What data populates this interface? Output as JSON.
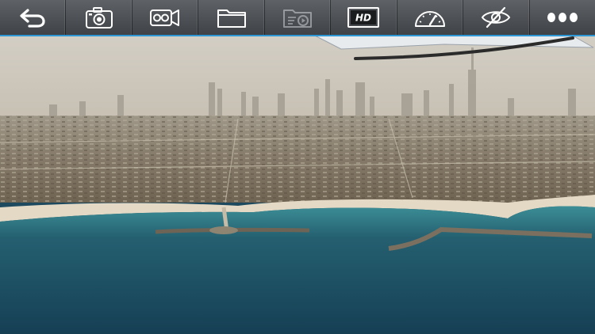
{
  "toolbar": {
    "accent_color": "#2e97d6",
    "buttons": [
      {
        "id": "back",
        "icon": "back-arrow-icon"
      },
      {
        "id": "photo",
        "icon": "camera-icon"
      },
      {
        "id": "record",
        "icon": "video-camera-icon"
      },
      {
        "id": "media",
        "icon": "folder-icon"
      },
      {
        "id": "playback",
        "icon": "media-playback-icon",
        "state": "disabled"
      },
      {
        "id": "quality",
        "icon": "hd-icon",
        "label": "HD"
      },
      {
        "id": "gauge",
        "icon": "speedometer-icon"
      },
      {
        "id": "visibility",
        "icon": "eye-hidden-icon"
      },
      {
        "id": "more",
        "icon": "more-dots-icon"
      }
    ]
  },
  "feed": {
    "description_colors": {
      "sky": "#cfcbc2",
      "city": "#8c8170",
      "beach": "#e6dcc9",
      "sea": "#1f5568"
    }
  }
}
